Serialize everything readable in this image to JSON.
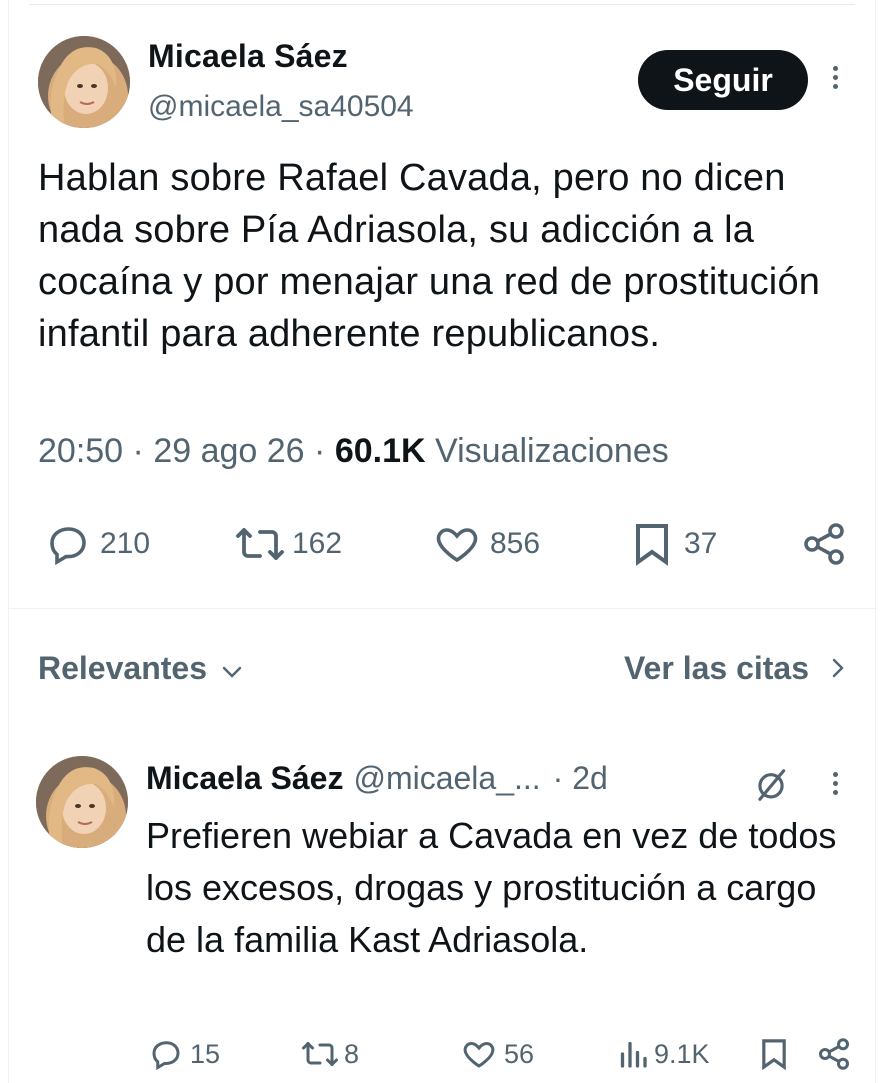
{
  "tweet": {
    "author_name": "Micaela Sáez",
    "author_handle": "@micaela_sa40504",
    "follow_label": "Seguir",
    "text": "Hablan sobre Rafael Cavada, pero no dicen nada sobre Pía Adriasola, su adicción a la cocaína y por menajar una red de prostitución infantil para adherente republicanos.",
    "time": "20:50",
    "date": "29 ago 26",
    "views_count": "60.1K",
    "views_label": "Visualizaciones",
    "sep": "·",
    "stats": {
      "replies": "210",
      "retweets": "162",
      "likes": "856",
      "bookmarks": "37"
    }
  },
  "replies_bar": {
    "sort_label": "Relevantes",
    "quotes_label": "Ver las citas"
  },
  "reply": {
    "author_name": "Micaela Sáez",
    "author_handle": "@micaela_...",
    "age": "· 2d",
    "text": "Prefieren webiar a Cavada en vez de todos los excesos, drogas y prostitución a cargo de la familia Kast Adriasola.",
    "stats": {
      "replies": "15",
      "retweets": "8",
      "likes": "56",
      "views": "9.1K"
    }
  },
  "icons": {
    "reply": "speech-bubble-icon",
    "retweet": "retweet-arrows-icon",
    "like": "heart-icon",
    "bookmark": "bookmark-icon",
    "share": "share-nodes-icon",
    "views": "bar-chart-icon",
    "grok": "grok-slash-icon",
    "more": "vertical-dots-icon",
    "chevron_down": "chevron-down-icon",
    "chevron_right": "chevron-right-icon"
  },
  "colors": {
    "text_primary": "#0f1419",
    "text_secondary": "#536471",
    "button_bg": "#0f1419",
    "divider": "#eff3f4"
  }
}
